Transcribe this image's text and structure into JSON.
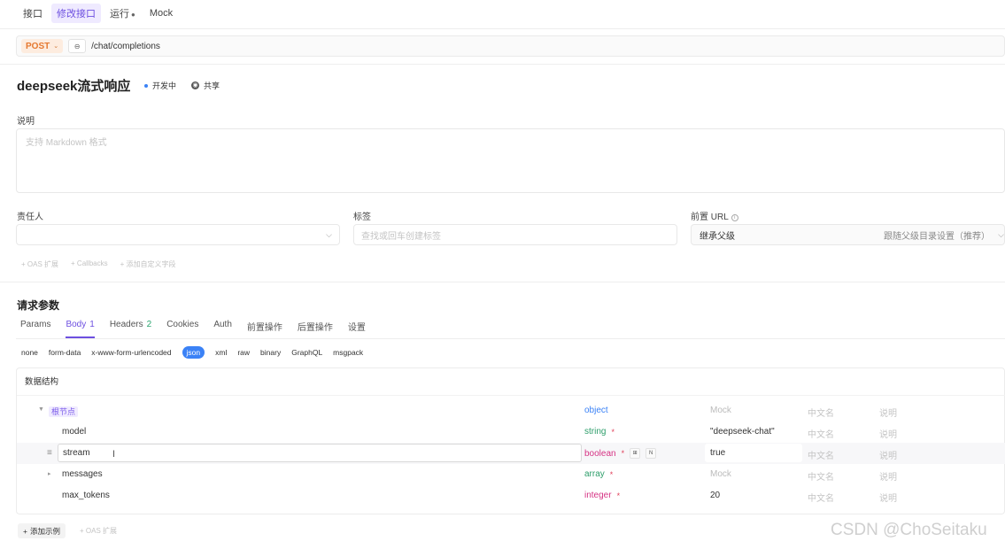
{
  "tabs": [
    {
      "label": "接口"
    },
    {
      "label": "修改接口"
    },
    {
      "label": "运行"
    },
    {
      "label": "Mock"
    }
  ],
  "url": {
    "method": "POST",
    "link_icon": "link-icon",
    "path": "/chat/completions"
  },
  "api": {
    "title": "deepseek流式响应",
    "status": "开发中",
    "share": "共享",
    "status_color": "#3b82f6"
  },
  "description": {
    "label": "说明",
    "placeholder": "支持 Markdown 格式"
  },
  "owner": {
    "label": "责任人"
  },
  "tags": {
    "label": "标签",
    "placeholder": "查找或回车创建标签"
  },
  "prefix_url": {
    "label": "前置 URL",
    "value": "继承父级",
    "hint": "跟随父级目录设置（推荐）"
  },
  "ext_links": [
    "+ OAS 扩展",
    "+ Callbacks",
    "+ 添加自定义字段"
  ],
  "request": {
    "title": "请求参数",
    "tabs": [
      {
        "label": "Params",
        "count": ""
      },
      {
        "label": "Body",
        "count": "1"
      },
      {
        "label": "Headers",
        "count": "2"
      },
      {
        "label": "Cookies",
        "count": ""
      },
      {
        "label": "Auth",
        "count": ""
      },
      {
        "label": "前置操作",
        "count": ""
      },
      {
        "label": "后置操作",
        "count": ""
      },
      {
        "label": "设置",
        "count": ""
      }
    ],
    "body_types": [
      "none",
      "form-data",
      "x-www-form-urlencoded",
      "json",
      "xml",
      "raw",
      "binary",
      "GraphQL",
      "msgpack"
    ],
    "active_body_type": "json"
  },
  "schema": {
    "title": "数据结构",
    "root": {
      "name": "根节点",
      "type": "object",
      "mock": "Mock",
      "cn": "中文名",
      "desc": "说明"
    },
    "rows": [
      {
        "name": "model",
        "type": "string",
        "required": "*",
        "mock": "\"deepseek-chat\"",
        "cn": "中文名",
        "desc": "说明"
      },
      {
        "name": "stream",
        "type": "boolean",
        "required": "*",
        "mock": "true",
        "cn": "中文名",
        "desc": "说明"
      },
      {
        "name": "messages",
        "type": "array",
        "required": "*",
        "mock": "Mock",
        "cn": "中文名",
        "desc": "说明"
      },
      {
        "name": "max_tokens",
        "type": "integer",
        "required": "*",
        "mock": "20",
        "cn": "中文名",
        "desc": "说明"
      }
    ]
  },
  "footer": {
    "add_example": "添加示例",
    "oas": "+ OAS 扩展"
  },
  "watermark": "CSDN @ChoSeitaku",
  "accent_color": "#6d4fe0"
}
